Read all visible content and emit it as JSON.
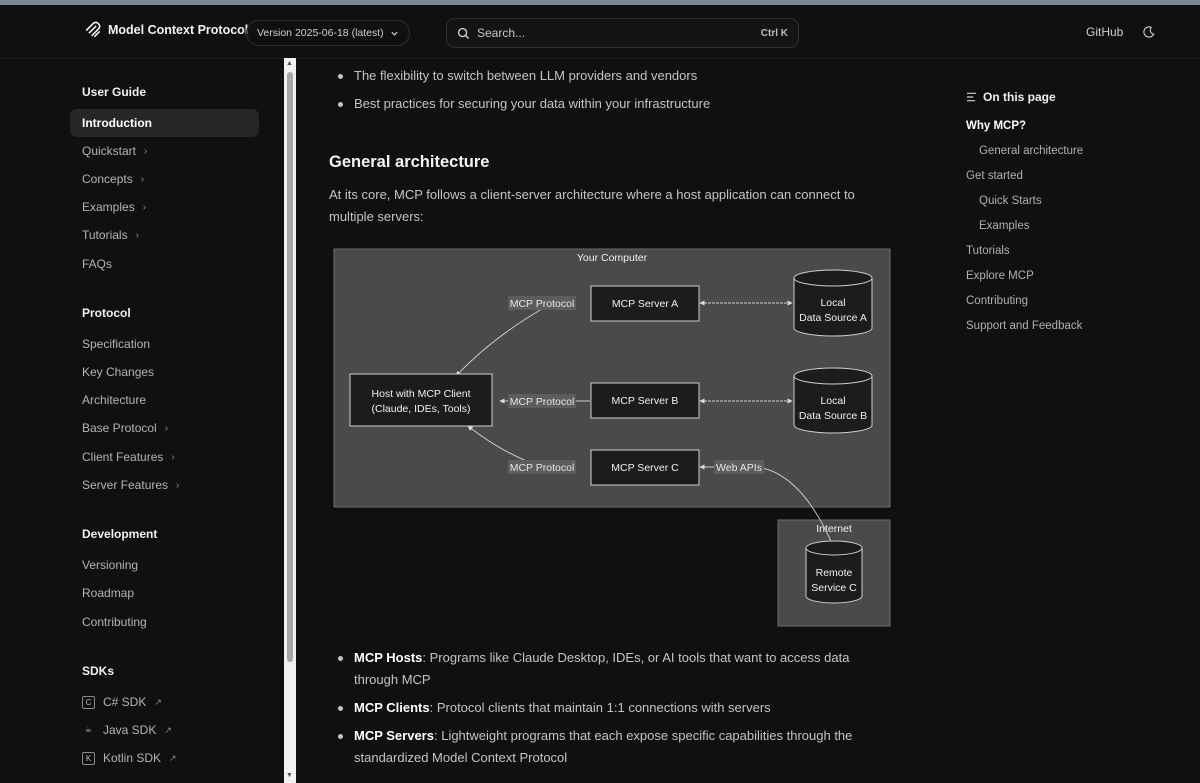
{
  "header": {
    "logo_text": "Model Context Protocol",
    "version_label": "Version 2025-06-18 (latest)",
    "search_placeholder": "Search...",
    "search_shortcut": "Ctrl K",
    "github_label": "GitHub"
  },
  "sidebar": {
    "user_guide": {
      "heading": "User Guide",
      "active": "Introduction",
      "items": [
        "Quickstart",
        "Concepts",
        "Examples",
        "Tutorials",
        "FAQs"
      ]
    },
    "protocol": {
      "heading": "Protocol",
      "items": [
        "Specification",
        "Key Changes",
        "Architecture",
        "Base Protocol",
        "Client Features",
        "Server Features"
      ]
    },
    "development": {
      "heading": "Development",
      "items": [
        "Versioning",
        "Roadmap",
        "Contributing"
      ]
    },
    "sdks": {
      "heading": "SDKs",
      "items": [
        "C# SDK",
        "Java SDK",
        "Kotlin SDK"
      ]
    }
  },
  "content": {
    "top_bullets": [
      "The flexibility to switch between LLM providers and vendors",
      "Best practices for securing your data within your infrastructure"
    ],
    "section_title": "General architecture",
    "intro": "At its core, MCP follows a client-server architecture where a host application can connect to multiple servers:",
    "diagram": {
      "computer_label": "Your Computer",
      "internet_label": "Internet",
      "host_line1": "Host with MCP Client",
      "host_line2": "(Claude, IDEs, Tools)",
      "server_a": "MCP Server A",
      "server_b": "MCP Server B",
      "server_c": "MCP Server C",
      "protocol_label": "MCP Protocol",
      "web_apis": "Web APIs",
      "local_label": "Local",
      "source_a": "Data Source A",
      "source_b": "Data Source B",
      "remote_line1": "Remote",
      "remote_line2": "Service C"
    },
    "bullets": [
      {
        "term": "MCP Hosts",
        "text": ": Programs like Claude Desktop, IDEs, or AI tools that want to access data through MCP"
      },
      {
        "term": "MCP Clients",
        "text": ": Protocol clients that maintain 1:1 connections with servers"
      },
      {
        "term": "MCP Servers",
        "text": ": Lightweight programs that each expose specific capabilities through the standardized Model Context Protocol"
      }
    ]
  },
  "toc": {
    "heading": "On this page",
    "items": [
      "Why MCP?",
      "General architecture",
      "Get started",
      "Quick Starts",
      "Examples",
      "Tutorials",
      "Explore MCP",
      "Contributing",
      "Support and Feedback"
    ]
  }
}
